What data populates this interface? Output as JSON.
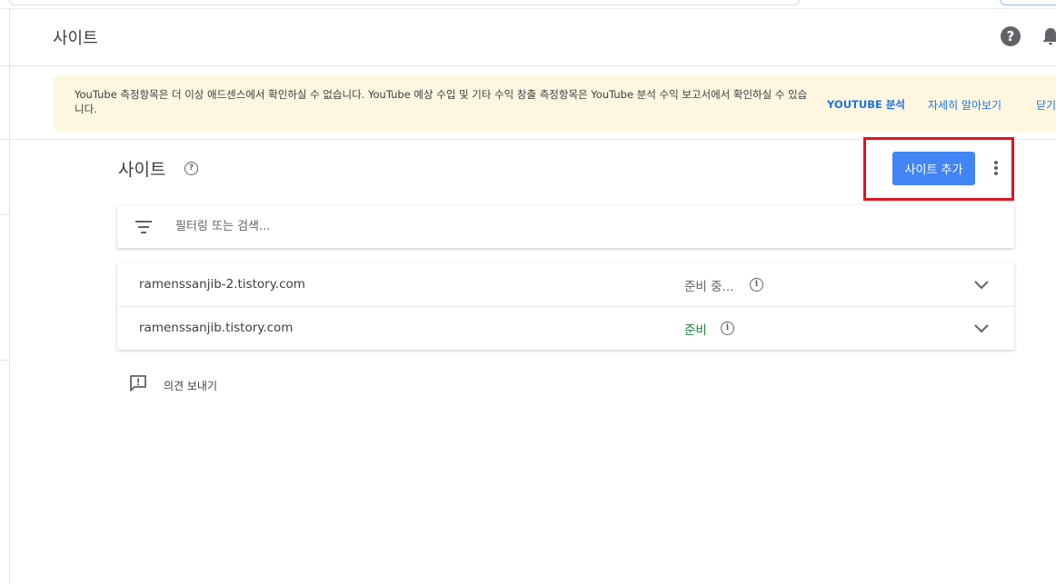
{
  "header": {
    "title": "사이트"
  },
  "banner": {
    "message": "YouTube 측정항목은 더 이상 애드센스에서 확인하실 수 없습니다. YouTube 예상 수입 및 기타 수익 창출 측정항목은 YouTube 분석 수익 보고서에서 확인하실 수 있습니다.",
    "youtube_link": "YOUTUBE 분석",
    "learn_more": "자세히 알아보기",
    "close": "닫기"
  },
  "section": {
    "title": "사이트",
    "add_button": "사이트 추가"
  },
  "filter": {
    "placeholder": "필터링 또는 검색..."
  },
  "sites": [
    {
      "domain": "ramenssanjib-2.tistory.com",
      "status": "준비 중..."
    },
    {
      "domain": "ramenssanjib.tistory.com",
      "status": "준비"
    }
  ],
  "feedback": {
    "label": "의견 보내기"
  },
  "colors": {
    "primary": "#4285f4",
    "link": "#1a73e8",
    "ready": "#188038",
    "banner_bg": "#fef7e0",
    "highlight": "#e0141e"
  }
}
